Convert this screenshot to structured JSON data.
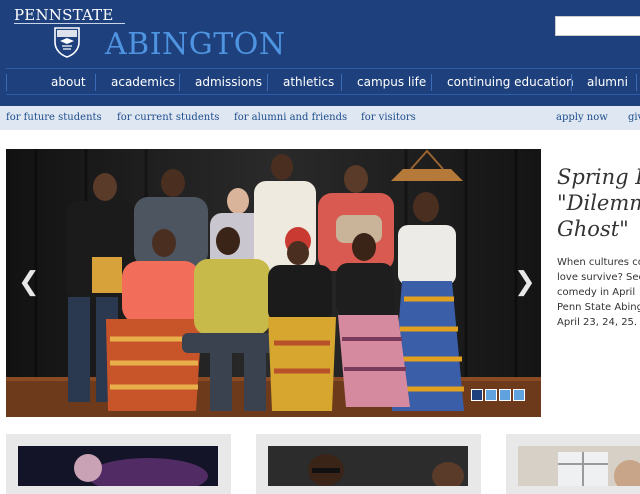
{
  "brand": {
    "university": "PENNSTATE",
    "campus": "ABINGTON"
  },
  "search": {
    "placeholder": ""
  },
  "main_nav": [
    {
      "label": "about"
    },
    {
      "label": "academics"
    },
    {
      "label": "admissions"
    },
    {
      "label": "athletics"
    },
    {
      "label": "campus life"
    },
    {
      "label": "continuing education"
    },
    {
      "label": "alumni"
    }
  ],
  "sub_nav": {
    "left": [
      {
        "label": "for future students"
      },
      {
        "label": "for current students"
      },
      {
        "label": "for alumni and friends"
      },
      {
        "label": "for visitors"
      }
    ],
    "right": [
      {
        "label": "apply now"
      },
      {
        "label": "giv"
      }
    ]
  },
  "hero": {
    "prev_icon": "chevron-left-icon",
    "next_icon": "chevron-right-icon",
    "slide_count": 4,
    "active_slide": 1
  },
  "caption": {
    "title": "Spring P\n\"Dilemm\nGhost\"",
    "body": "When cultures co\nlove survive? See\ncomedy in April\nPenn State Abing\nApril 23, 24, 25."
  },
  "colors": {
    "header_bg": "#1e407c",
    "campus_text": "#4e94e0",
    "subnav_bg": "#dfe8f2",
    "subnav_text": "#1e4c8c"
  }
}
